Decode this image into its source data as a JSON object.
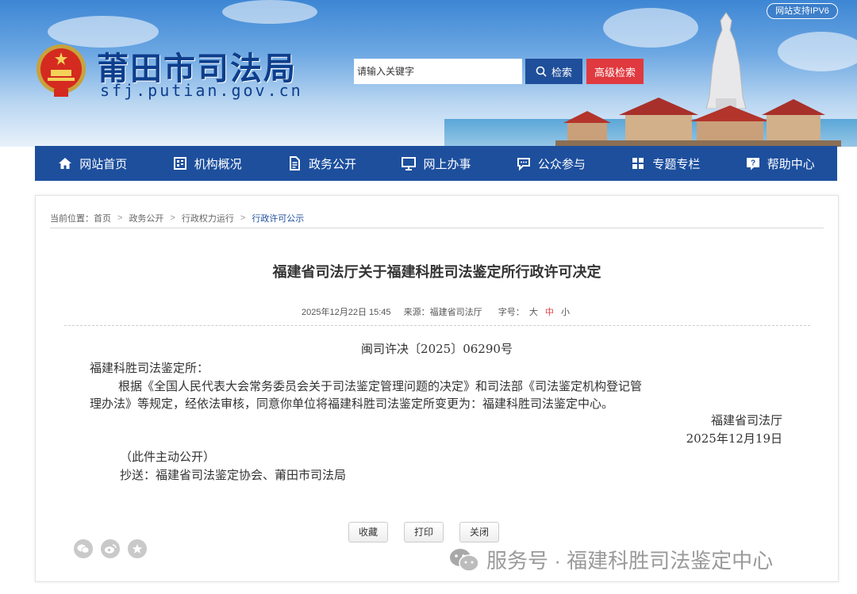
{
  "header": {
    "site_name": "莆田市司法局",
    "site_url": "sfj.putian.gov.cn",
    "ipv6_badge": "网站支持IPV6",
    "search_placeholder": "请输入关键字",
    "search_button": "检索",
    "advanced_search_button": "高级检索"
  },
  "nav": {
    "items": [
      {
        "label": "网站首页",
        "icon": "home-icon"
      },
      {
        "label": "机构概况",
        "icon": "org-icon"
      },
      {
        "label": "政务公开",
        "icon": "document-icon"
      },
      {
        "label": "网上办事",
        "icon": "monitor-icon"
      },
      {
        "label": "公众参与",
        "icon": "chat-icon"
      },
      {
        "label": "专题专栏",
        "icon": "grid-icon"
      },
      {
        "label": "帮助中心",
        "icon": "help-icon"
      }
    ]
  },
  "breadcrumb": {
    "prefix": "当前位置：",
    "items": [
      "首页",
      "政务公开",
      "行政权力运行",
      "行政许可公示"
    ]
  },
  "article": {
    "title": "福建省司法厅关于福建科胜司法鉴定所行政许可决定",
    "date": "2025年12月22日 15:45",
    "source": "来源：福建省司法厅",
    "font_size_label": "字号：",
    "font_sizes": [
      "大",
      "中",
      "小"
    ],
    "doc_number": "闽司许决〔2025〕06290号",
    "recipient": "福建科胜司法鉴定所：",
    "body_line1": "根据《全国人民代表大会常务委员会关于司法鉴定管理问题的决定》和司法部《司法鉴定机构登记管",
    "body_line2": "理办法》等规定，经依法审核，同意你单位将福建科胜司法鉴定所变更为：福建科胜司法鉴定中心。",
    "issuer": "福建省司法厅",
    "issue_date": "2025年12月19日",
    "disclosure": "（此件主动公开）",
    "cc": "抄送：福建省司法鉴定协会、莆田市司法局"
  },
  "actions": {
    "favorite": "收藏",
    "print": "打印",
    "close": "关闭"
  },
  "share_icons": [
    "wechat-icon",
    "weibo-icon",
    "star-icon"
  ],
  "watermark": "服务号 · 福建科胜司法鉴定中心",
  "colors": {
    "nav_bg": "#1d4f9d",
    "search_btn": "#1f4f9a",
    "advanced_btn": "#e0393f",
    "breadcrumb_current": "#1d4f9d",
    "font_size_active": "#e0393f"
  }
}
